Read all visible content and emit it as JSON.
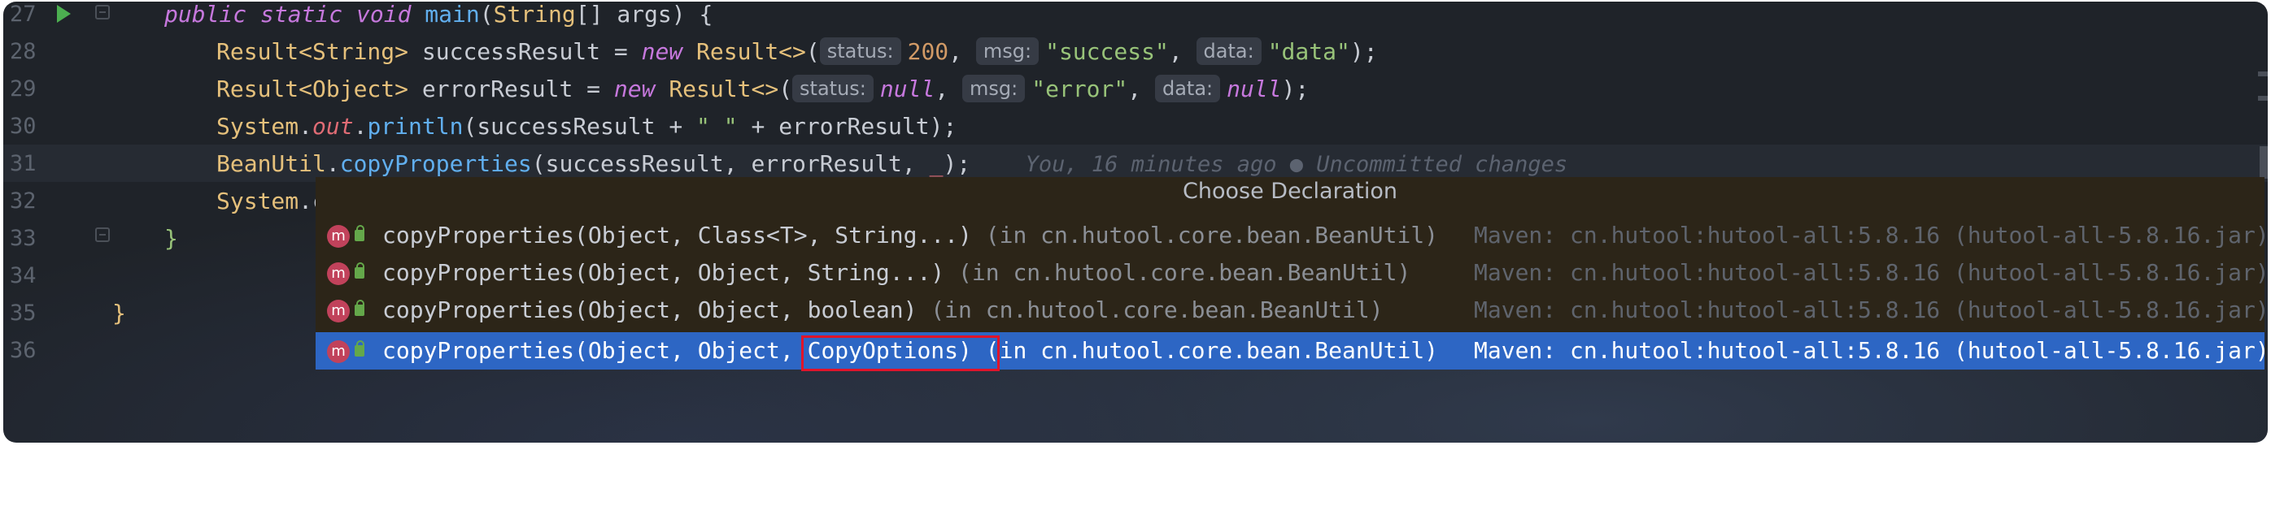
{
  "editor": {
    "line_numbers": [
      "27",
      "28",
      "29",
      "30",
      "31",
      "32",
      "33",
      "34",
      "35",
      "36"
    ],
    "code": {
      "l27": {
        "kw1": "public static void ",
        "fn": "main",
        "p1": "(",
        "ty": "String",
        "p2": "[] args) {"
      },
      "l28": {
        "ty1": "Result<String>",
        "t1": " successResult = ",
        "kw": "new",
        "t2": " ",
        "ty2": "Result<>",
        "p1": "(",
        "h1": "status:",
        "v1": "200",
        "c1": ", ",
        "h2": "msg:",
        "v2": "\"success\"",
        "c2": ", ",
        "h3": "data:",
        "v3": "\"data\"",
        "end": ");"
      },
      "l29": {
        "ty1": "Result<Object>",
        "t1": " errorResult = ",
        "kw": "new",
        "t2": " ",
        "ty2": "Result<>",
        "p1": "(",
        "h1": "status:",
        "v1": "null",
        "c1": ", ",
        "h2": "msg:",
        "v2": "\"error\"",
        "c2": ", ",
        "h3": "data:",
        "v3": "null",
        "end": ");"
      },
      "l30": {
        "ty": "System",
        "d1": ".",
        "fld": "out",
        "d2": ".",
        "fn": "println",
        "rest": "(successResult + ",
        "s": "\" \"",
        "rest2": " + errorResult);"
      },
      "l31": {
        "ty": "BeanUtil",
        "d1": ".",
        "fn": "copyProperties",
        "rest": "(successResult, errorResult, ",
        "tilde": "_",
        "end": ");"
      },
      "l31_blame": "You, 16 minutes ago ● Uncommitted changes",
      "l32": {
        "ty": "System",
        "rest": ".c"
      },
      "l33": "}",
      "l35": "}"
    }
  },
  "popup": {
    "title": "Choose Declaration",
    "badge": "m",
    "rows": [
      {
        "sig": "copyProperties(Object, Class<T>, String...)",
        "loc": " (in cn.hutool.core.bean.BeanUtil)",
        "maven": "Maven: cn.hutool:hutool-all:5.8.16 (hutool-all-5.8.16.jar)"
      },
      {
        "sig": "copyProperties(Object, Object, String...)",
        "loc": " (in cn.hutool.core.bean.BeanUtil)",
        "maven": "Maven: cn.hutool:hutool-all:5.8.16 (hutool-all-5.8.16.jar)"
      },
      {
        "sig": "copyProperties(Object, Object, boolean)",
        "loc": " (in cn.hutool.core.bean.BeanUtil)",
        "maven": "Maven: cn.hutool:hutool-all:5.8.16 (hutool-all-5.8.16.jar)"
      },
      {
        "sig": "copyProperties(Object, Object, CopyOptions)",
        "loc": " (in cn.hutool.core.bean.BeanUtil)",
        "maven": "Maven: cn.hutool:hutool-all:5.8.16 (hutool-all-5.8.16.jar)"
      }
    ]
  },
  "colors": {
    "selection": "#2d66c4",
    "highlight_box": "#e0142a",
    "popup_bg": "#2c2518"
  }
}
